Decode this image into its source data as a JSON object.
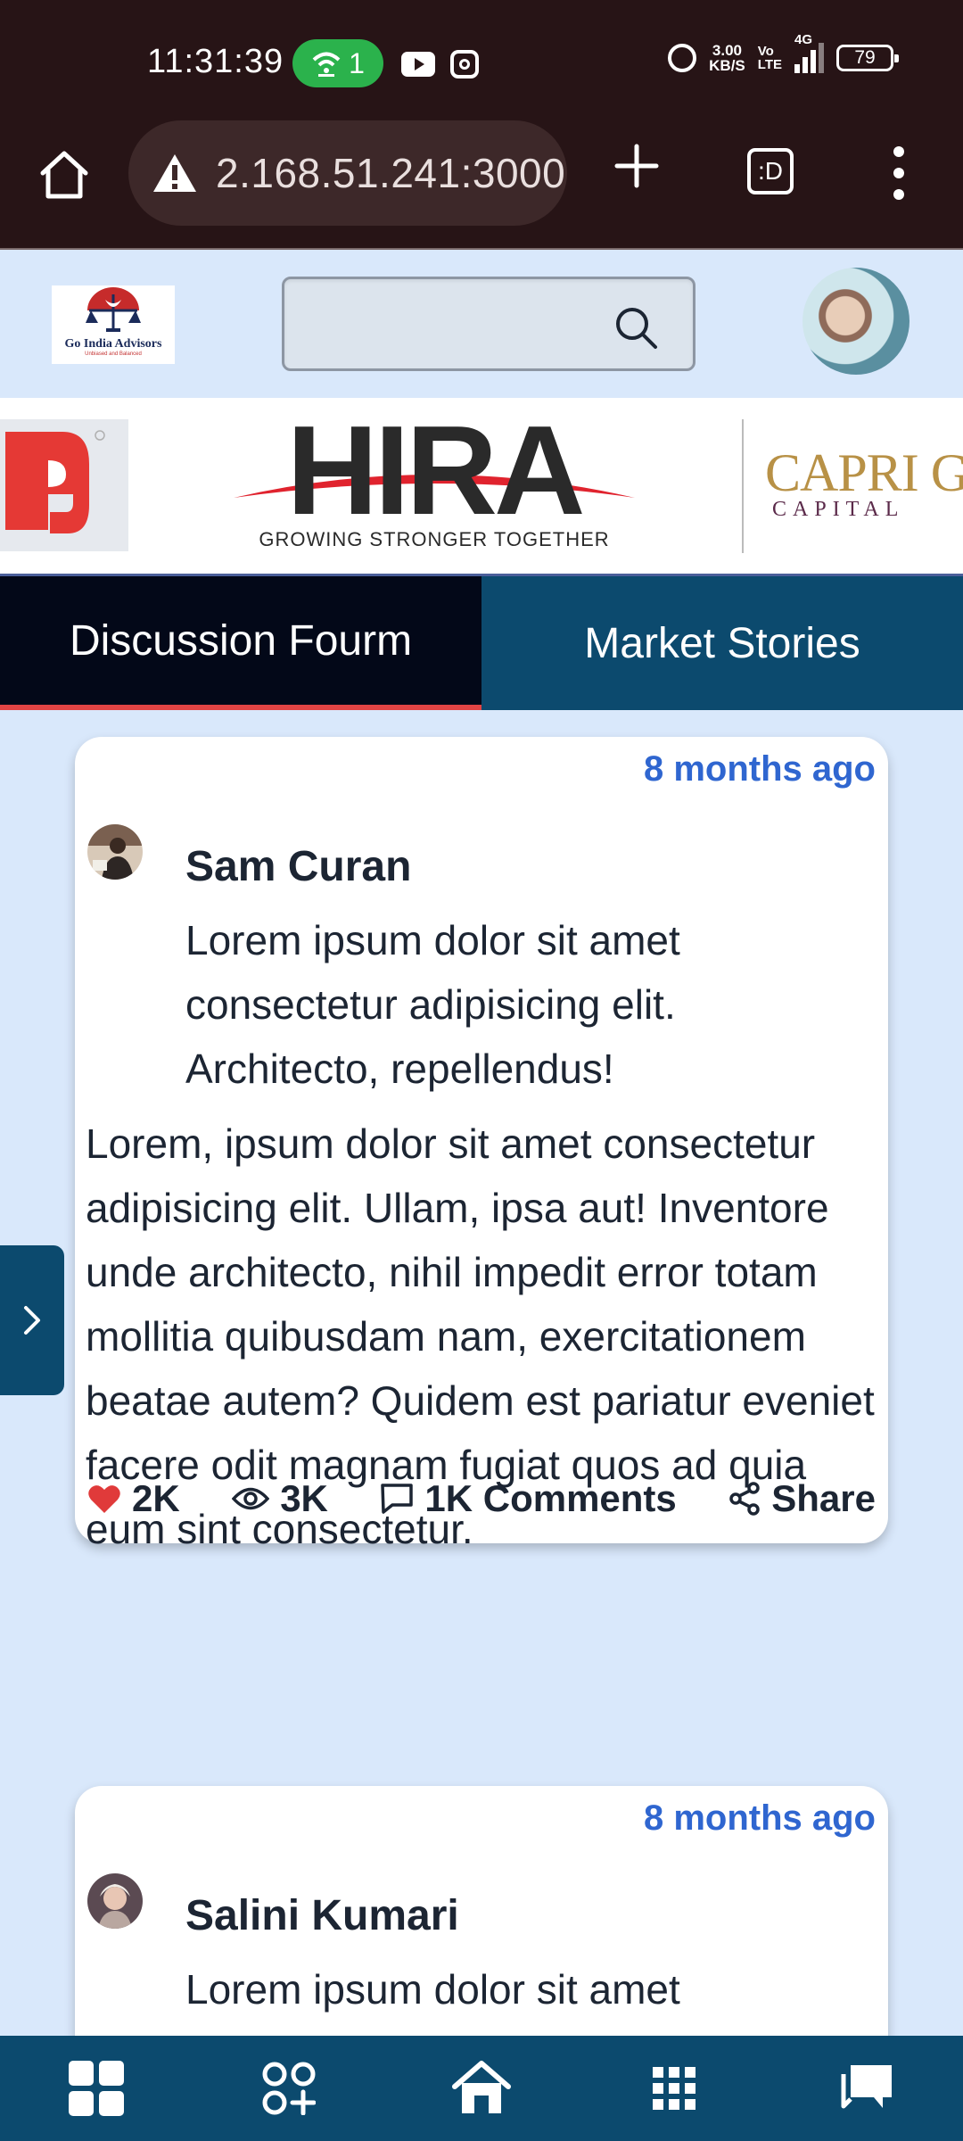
{
  "status_bar": {
    "time": "11:31:39",
    "hotspot_count": "1",
    "net_speed_value": "3.00",
    "net_speed_unit": "KB/S",
    "volte_top": "Vo",
    "volte_bottom": "LTE",
    "network_type": "4G",
    "battery": "79"
  },
  "browser": {
    "url": "2.168.51.241:3000",
    "tabs_label": ":D"
  },
  "header": {
    "logo_name": "Go India Advisors",
    "logo_tagline": "Unbiased and Balanced",
    "search_placeholder": ""
  },
  "banner": {
    "hira_brand": "HIRA",
    "hira_tagline": "GROWING STRONGER TOGETHER",
    "capri_brand": "CAPRI G",
    "capri_sub": "CAPITAL"
  },
  "tabs": [
    {
      "label": "Discussion Fourm",
      "active": true
    },
    {
      "label": "Market Stories",
      "active": false
    }
  ],
  "posts": [
    {
      "time": "8 months ago",
      "author": "Sam Curan",
      "title": "Lorem ipsum dolor sit amet consectetur adipisicing elit. Architecto, repellendus!",
      "body": "Lorem, ipsum dolor sit amet consectetur adipisicing elit. Ullam, ipsa aut! Inventore unde architecto, nihil impedit error totam mollitia quibusdam nam, exercitationem beatae autem? Quidem est pariatur eveniet facere odit magnam fugiat quos ad quia eum sint consectetur.",
      "likes": "2K",
      "views": "3K",
      "comments": "1K Comments",
      "share": "Share"
    },
    {
      "time": "8 months ago",
      "author": "Salini Kumari",
      "title": "Lorem ipsum dolor sit amet consectetur adipisicing elit."
    }
  ],
  "colors": {
    "accent_blue": "#2f66d0",
    "nav_bg": "#0c4a6e",
    "active_tab_bg": "#030818",
    "active_tab_underline": "#e24444",
    "heart": "#e03a3a",
    "page_bg": "#d9e8fb"
  },
  "bottom_nav": [
    {
      "icon": "dashboard-icon"
    },
    {
      "icon": "add-apps-icon"
    },
    {
      "icon": "home-icon"
    },
    {
      "icon": "grid-icon"
    },
    {
      "icon": "chat-icon"
    }
  ]
}
